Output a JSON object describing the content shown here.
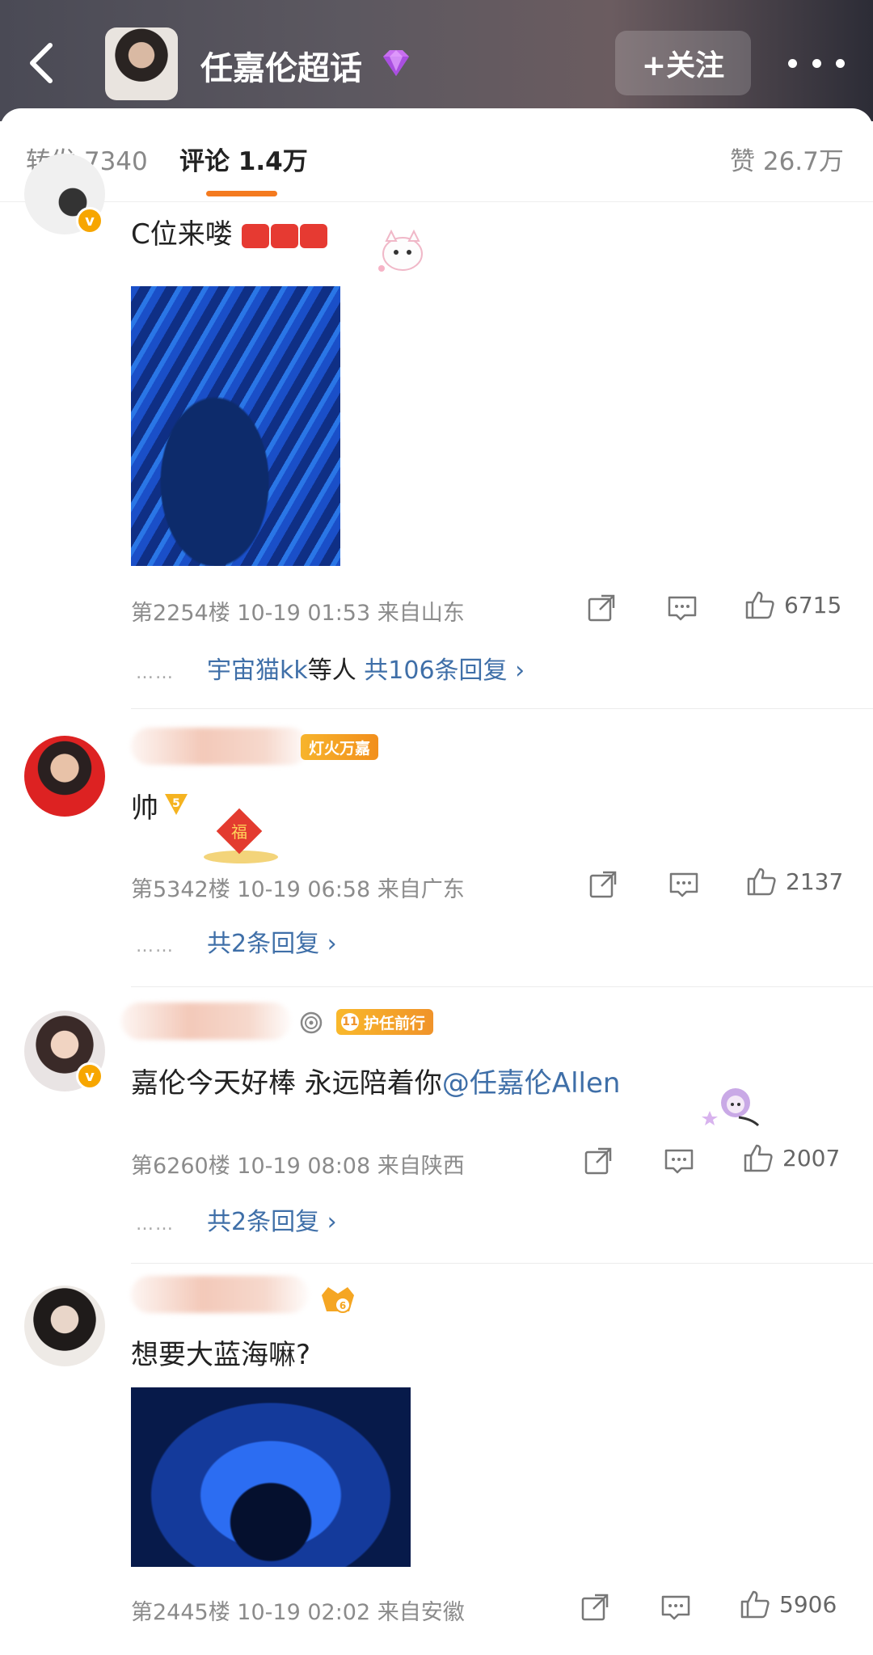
{
  "header": {
    "title": "任嘉伦超话",
    "follow_label": "+关注"
  },
  "tabs": {
    "repost": "转发 7340",
    "comment": "评论 1.4万",
    "like": "赞 26.7万"
  },
  "comments": [
    {
      "text": "C位来喽",
      "emoji": "[加油][加油][加油]",
      "meta": "第2254楼  10-19 01:53  来自山东",
      "likes": "6715",
      "replies_dots": "……",
      "replies_users": "宇宙猫kk",
      "replies_users_suffix": "等人",
      "replies_link": "共106条回复 ›"
    },
    {
      "badge": "灯火万嘉",
      "text": "帅",
      "meta": "第5342楼  10-19 06:58  来自广东",
      "likes": "2137",
      "replies_dots": "……",
      "replies_link": "共2条回复 ›"
    },
    {
      "badge": "护任前行",
      "badge_level": "11",
      "text": "嘉伦今天好棒 永远陪着你",
      "mention": "@任嘉伦Allen",
      "meta": "第6260楼  10-19 08:08  来自陕西",
      "likes": "2007",
      "replies_dots": "……",
      "replies_link": "共2条回复 ›"
    },
    {
      "badge_level": "6",
      "text": "想要大蓝海嘛?",
      "meta": "第2445楼  10-19 02:02  来自安徽",
      "likes": "5906"
    }
  ],
  "colors": {
    "accent_orange": "#f47a1f",
    "link_blue": "#3f6fa8",
    "badge_gold": "#f7a600"
  }
}
